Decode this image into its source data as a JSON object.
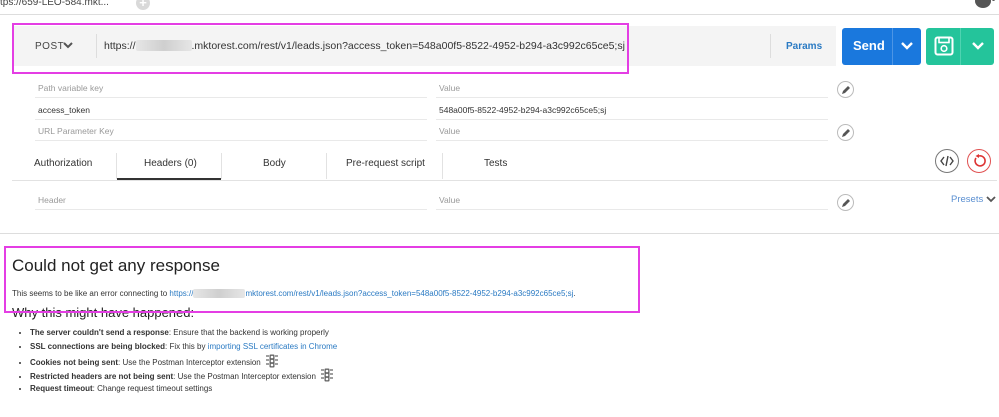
{
  "browser": {
    "tab_title": "tps://659-LEO-584.mkt..."
  },
  "request": {
    "method": "POST",
    "url_prefix": "https://",
    "url_suffix": ".mktorest.com/rest/v1/leads.json?access_token=548a00f5-8522-4952-b294-a3c992c65ce5;sj",
    "params_label": "Params",
    "send_label": "Send",
    "send_color": "#1a78dd",
    "save_color": "#24c49b",
    "highlight_color": "#e43ee4"
  },
  "params_grid": {
    "path_key_placeholder": "Path variable key",
    "path_value_placeholder": "Value",
    "rows": [
      {
        "key": "access_token",
        "value": "548a00f5-8522-4952-b294-a3c992c65ce5;sj"
      }
    ],
    "url_key_placeholder": "URL Parameter Key",
    "url_value_placeholder": "Value"
  },
  "tabs": [
    {
      "label": "Authorization"
    },
    {
      "label": "Headers (0)",
      "active": true
    },
    {
      "label": "Body"
    },
    {
      "label": "Pre-request script"
    },
    {
      "label": "Tests"
    }
  ],
  "headers_grid": {
    "header_placeholder": "Header",
    "value_placeholder": "Value",
    "presets_label": "Presets"
  },
  "response": {
    "title": "Could not get any response",
    "message_prefix": "This seems to be like an error connecting to ",
    "link_prefix": "https://",
    "link_suffix": "mktorest.com/rest/v1/leads.json?access_token=548a00f5-8522-4952-b294-a3c992c65ce5;sj",
    "message_end": ".",
    "why_heading": "Why this might have happened:",
    "reasons": [
      {
        "bold": "The server couldn't send a response",
        "text": ": Ensure that the backend is working properly",
        "link": "",
        "icon": ""
      },
      {
        "bold": "SSL connections are being blocked",
        "text": ": Fix this by ",
        "link": "importing SSL certificates in Chrome",
        "icon": ""
      },
      {
        "bold": "Cookies not being sent",
        "text": ": Use the Postman Interceptor extension",
        "link": "",
        "icon": "traffic-light-icon"
      },
      {
        "bold": "Restricted headers are not being sent",
        "text": ": Use the Postman Interceptor extension",
        "link": "",
        "icon": "traffic-light-icon"
      },
      {
        "bold": "Request timeout",
        "text": ": Change request timeout settings",
        "link": "",
        "icon": ""
      }
    ]
  }
}
